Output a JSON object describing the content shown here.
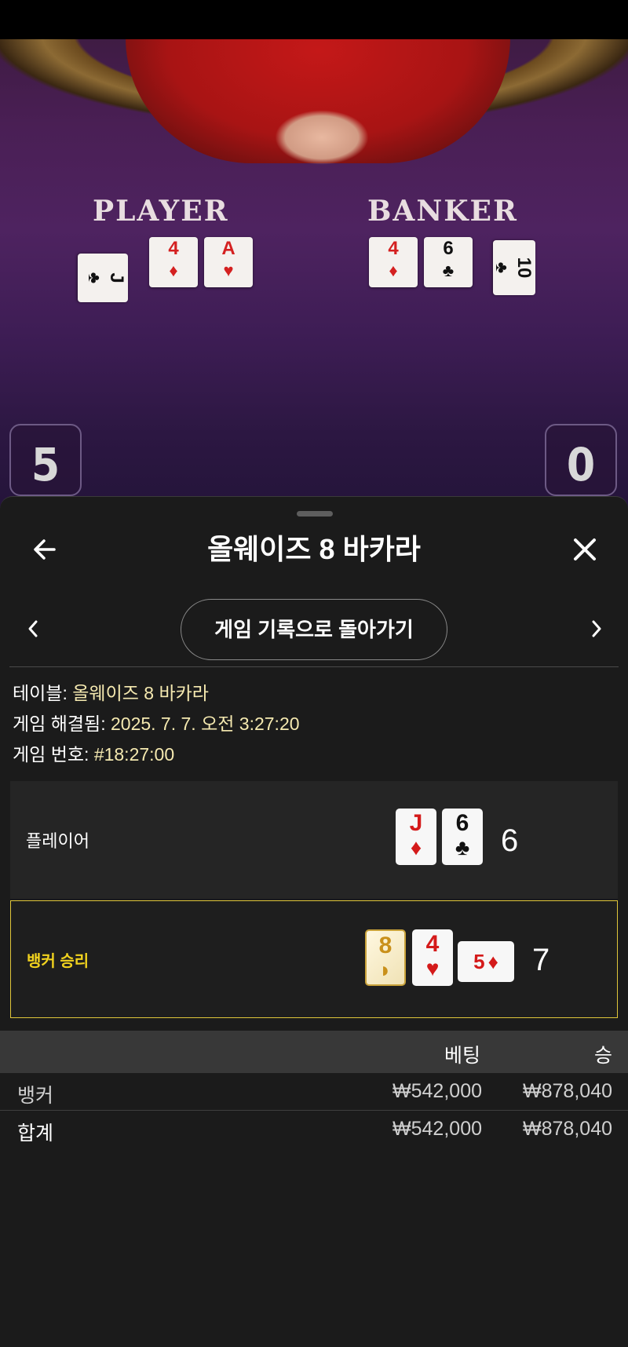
{
  "video": {
    "player_label": "PLAYER",
    "banker_label": "BANKER",
    "player_cards": [
      {
        "rank": "J",
        "suit": "♣",
        "color": "black"
      },
      {
        "rank": "4",
        "suit": "♦",
        "color": "red"
      },
      {
        "rank": "A",
        "suit": "♥",
        "color": "red"
      }
    ],
    "banker_cards": [
      {
        "rank": "4",
        "suit": "♦",
        "color": "red"
      },
      {
        "rank": "6",
        "suit": "♣",
        "color": "black"
      },
      {
        "rank": "10",
        "suit": "♣",
        "color": "black"
      }
    ],
    "left_score": "5",
    "right_score": "0"
  },
  "header": {
    "title": "올웨이즈 8 바카라",
    "back_icon": "arrow-left-icon",
    "close_icon": "close-icon"
  },
  "nav": {
    "back_to_history_label": "게임 기록으로 돌아가기",
    "prev_icon": "chevron-left-icon",
    "next_icon": "chevron-right-icon"
  },
  "info": {
    "table_key": "테이블:",
    "table_value": "올웨이즈 8 바카라",
    "resolved_key": "게임 해결됨:",
    "resolved_value": "2025. 7. 7. 오전 3:27:20",
    "number_key": "게임 번호:",
    "number_value": "#18:27:00"
  },
  "player_hand": {
    "label": "플레이어",
    "cards": [
      {
        "rank": "J",
        "suit": "♦",
        "color": "red"
      },
      {
        "rank": "6",
        "suit": "♣",
        "color": "black"
      }
    ],
    "total": "6"
  },
  "banker_hand": {
    "label": "뱅커 승리",
    "cards": [
      {
        "rank": "8",
        "suit": "",
        "color": "gold"
      },
      {
        "rank": "4",
        "suit": "♥",
        "color": "red"
      },
      {
        "rank": "5",
        "suit": "♦",
        "color": "red",
        "sideways": true
      }
    ],
    "total": "7"
  },
  "table": {
    "col_bet": "베팅",
    "col_win": "승",
    "rows": [
      {
        "name": "뱅커",
        "bet": "₩542,000",
        "win": "₩878,040"
      }
    ],
    "total": {
      "name": "합계",
      "bet": "₩542,000",
      "win": "₩878,040"
    }
  },
  "colors": {
    "accent_gold": "#f1d21e",
    "value_text": "#f5e9b0",
    "sheet_bg": "#1b1b1b"
  }
}
